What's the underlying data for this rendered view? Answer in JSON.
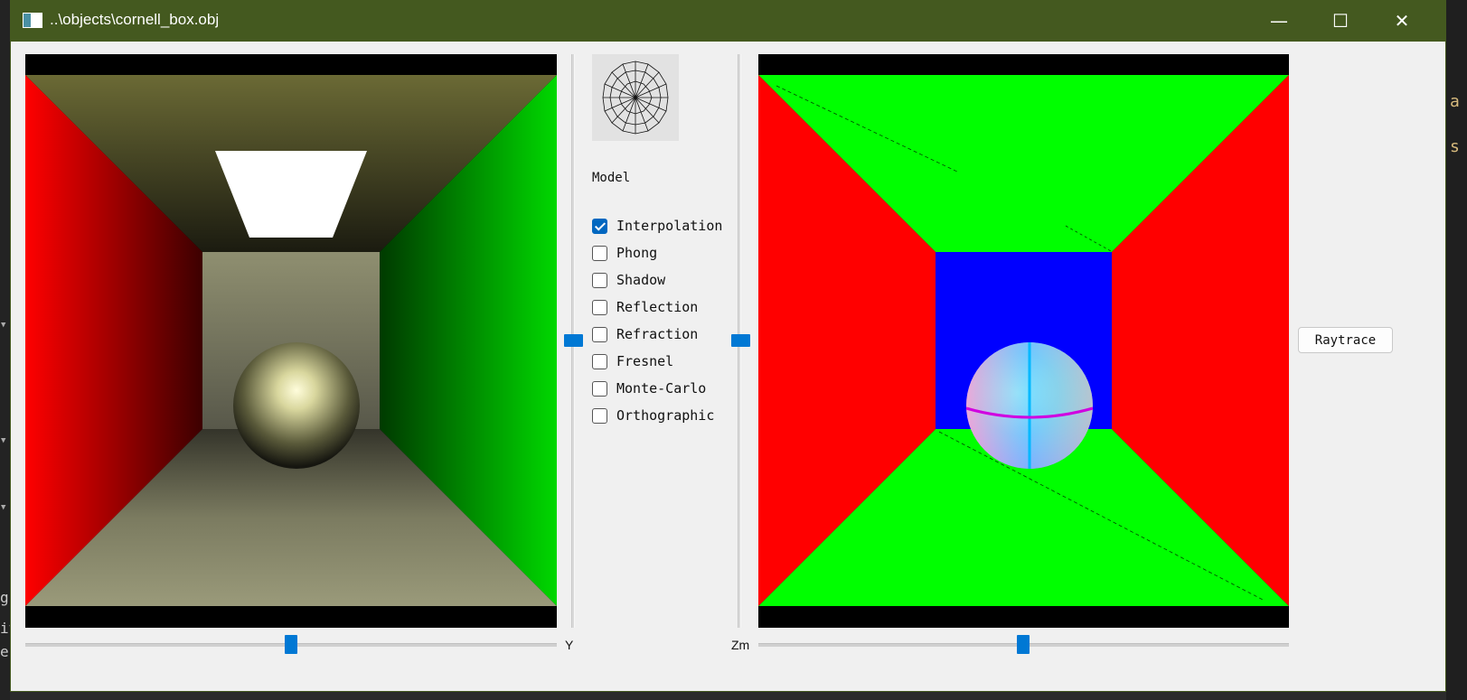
{
  "window": {
    "title": "..\\objects\\cornell_box.obj",
    "controls": {
      "minimize": "—",
      "maximize": "☐",
      "close": "✕"
    }
  },
  "viewports": {
    "left": {
      "render": "shaded-cornell-box"
    },
    "right": {
      "render": "normal-color-cornell-box"
    }
  },
  "sliders": {
    "left_label": "Y",
    "right_label": "Zm"
  },
  "panel": {
    "model_label": "Model",
    "options": [
      {
        "label": "Interpolation",
        "checked": true
      },
      {
        "label": "Phong",
        "checked": false
      },
      {
        "label": "Shadow",
        "checked": false
      },
      {
        "label": "Reflection",
        "checked": false
      },
      {
        "label": "Refraction",
        "checked": false
      },
      {
        "label": "Fresnel",
        "checked": false
      },
      {
        "label": "Monte-Carlo",
        "checked": false
      },
      {
        "label": "Orthographic",
        "checked": false
      }
    ]
  },
  "raytrace_button": "Raytrace",
  "background_fragments": {
    "right": [
      "a",
      "s"
    ],
    "left": [
      "g",
      "iv",
      "e"
    ]
  },
  "colors": {
    "titlebar": "#44591f",
    "accent": "#0078d4"
  }
}
